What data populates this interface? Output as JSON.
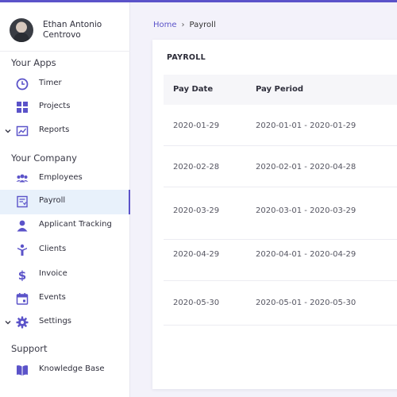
{
  "user": {
    "name": "Ethan Antonio Centrovo"
  },
  "sidebar": {
    "section_apps": "Your Apps",
    "section_company": "Your Company",
    "section_support": "Support",
    "items": [
      {
        "label": "Timer",
        "icon": "clock-icon"
      },
      {
        "label": "Projects",
        "icon": "grid-icon"
      },
      {
        "label": "Reports",
        "icon": "chart-icon"
      },
      {
        "label": "Employees",
        "icon": "people-icon"
      },
      {
        "label": "Payroll",
        "icon": "payroll-icon"
      },
      {
        "label": "Applicant Tracking",
        "icon": "person-icon"
      },
      {
        "label": "Clients",
        "icon": "client-icon"
      },
      {
        "label": "Invoice",
        "icon": "dollar-icon"
      },
      {
        "label": "Events",
        "icon": "calendar-icon"
      },
      {
        "label": "Settings",
        "icon": "gear-icon"
      },
      {
        "label": "Knowledge Base",
        "icon": "book-icon"
      }
    ]
  },
  "breadcrumb": {
    "home": "Home",
    "current": "Payroll",
    "separator": "›"
  },
  "card": {
    "title": "PAYROLL",
    "columns": [
      "Pay Date",
      "Pay Period"
    ],
    "rows": [
      [
        "2020-01-29",
        "2020-01-01 - 2020-01-29"
      ],
      [
        "2020-02-28",
        "2020-02-01 - 2020-04-28"
      ],
      [
        "2020-03-29",
        "2020-03-01 - 2020-03-29"
      ],
      [
        "2020-04-29",
        "2020-04-01 - 2020-04-29"
      ],
      [
        "2020-05-30",
        "2020-05-01 - 2020-05-30"
      ]
    ]
  },
  "colors": {
    "accent": "#5b53c9",
    "active_bg": "#e8f1fb"
  }
}
